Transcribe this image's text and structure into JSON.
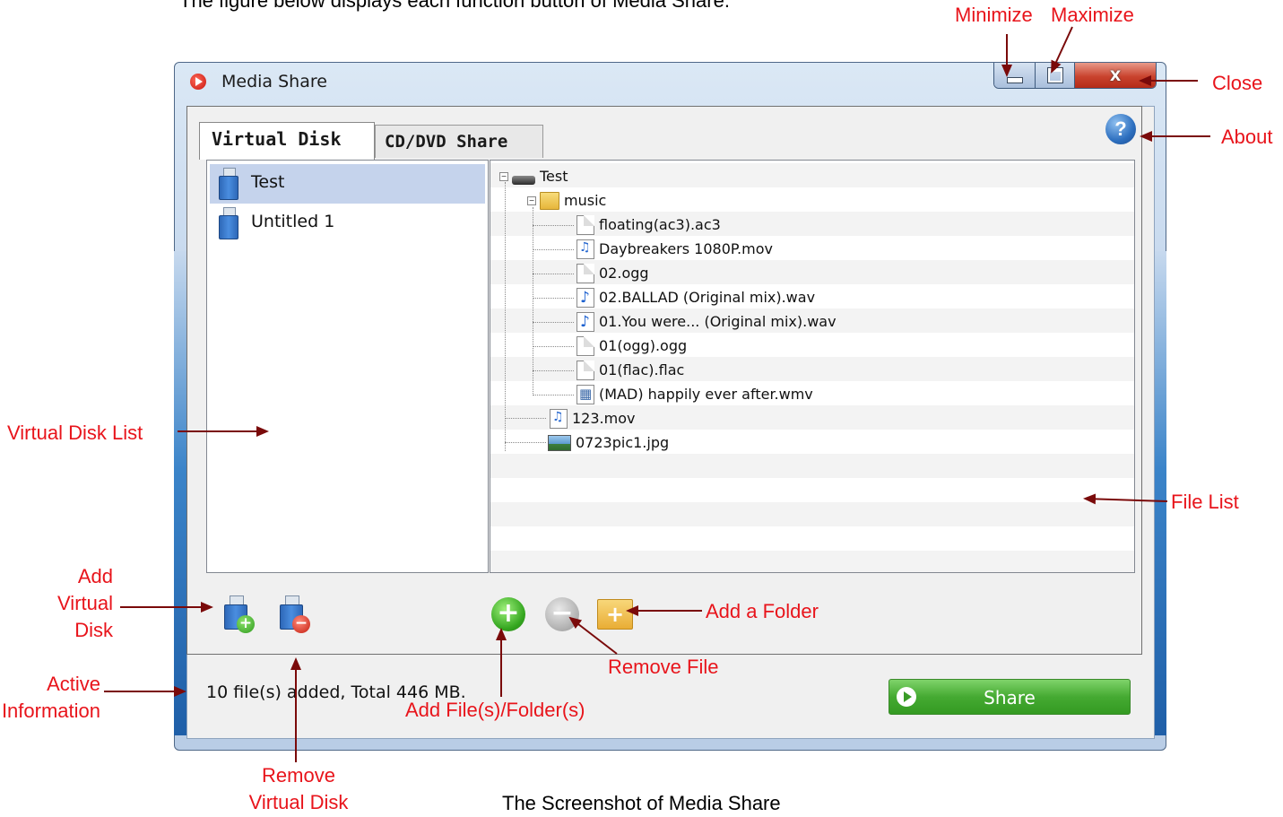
{
  "page": {
    "top_caption": "The figure below displays each function button of Media Share.",
    "bottom_caption": "The Screenshot of Media Share"
  },
  "window": {
    "title": "Media Share",
    "caption_buttons": {
      "minimize": "—",
      "maximize": "□",
      "close": "X"
    },
    "about_button": "?"
  },
  "tabs": [
    {
      "label": "Virtual Disk",
      "active": true
    },
    {
      "label": "CD/DVD Share",
      "active": false
    }
  ],
  "virtual_disks": [
    {
      "label": "Test",
      "selected": true
    },
    {
      "label": "Untitled 1",
      "selected": false
    }
  ],
  "file_tree": [
    {
      "label": "Test",
      "icon": "drive-icon",
      "depth": 0,
      "expander": "−"
    },
    {
      "label": "music",
      "icon": "folder-icon",
      "depth": 1,
      "expander": "−"
    },
    {
      "label": "floating(ac3).ac3",
      "icon": "document-icon",
      "depth": 2
    },
    {
      "label": "Daybreakers 1080P.mov",
      "icon": "movie-file-icon",
      "depth": 2
    },
    {
      "label": "02.ogg",
      "icon": "document-icon",
      "depth": 2
    },
    {
      "label": "02.BALLAD (Original mix).wav",
      "icon": "audio-file-icon",
      "depth": 2
    },
    {
      "label": "01.You were... (Original mix).wav",
      "icon": "audio-file-icon",
      "depth": 2
    },
    {
      "label": "01(ogg).ogg",
      "icon": "document-icon",
      "depth": 2
    },
    {
      "label": "01(flac).flac",
      "icon": "document-icon",
      "depth": 2
    },
    {
      "label": "(MAD) happily ever after.wmv",
      "icon": "video-file-icon",
      "depth": 2
    },
    {
      "label": "123.mov",
      "icon": "movie-file-icon",
      "depth": 1
    },
    {
      "label": "0723pic1.jpg",
      "icon": "image-file-icon",
      "depth": 1
    }
  ],
  "toolbar": {
    "add_disk_badge": "+",
    "remove_disk_badge": "−",
    "add_files_glyph": "+",
    "remove_file_glyph": "−",
    "add_folder_glyph": "+"
  },
  "status_text": "10 file(s) added, Total 446 MB.",
  "share_button": "Share",
  "callouts": {
    "minimize": "Minimize",
    "maximize": "Maximize",
    "close": "Close",
    "about": "About",
    "virtual_disk_list": "Virtual Disk List",
    "file_list": "File List",
    "add_virtual_disk": "Add\nVirtual\nDisk",
    "active_information": "Active\nInformation",
    "remove_virtual_disk": "Remove\nVirtual Disk",
    "add_files_folders": "Add File(s)/Folder(s)",
    "remove_file": "Remove File",
    "add_folder": "Add a Folder"
  },
  "colors": {
    "callout": "#e8141b",
    "arrow": "#7a0a0a",
    "selection": "#c5d3ec",
    "share_green": "#45aa32"
  }
}
